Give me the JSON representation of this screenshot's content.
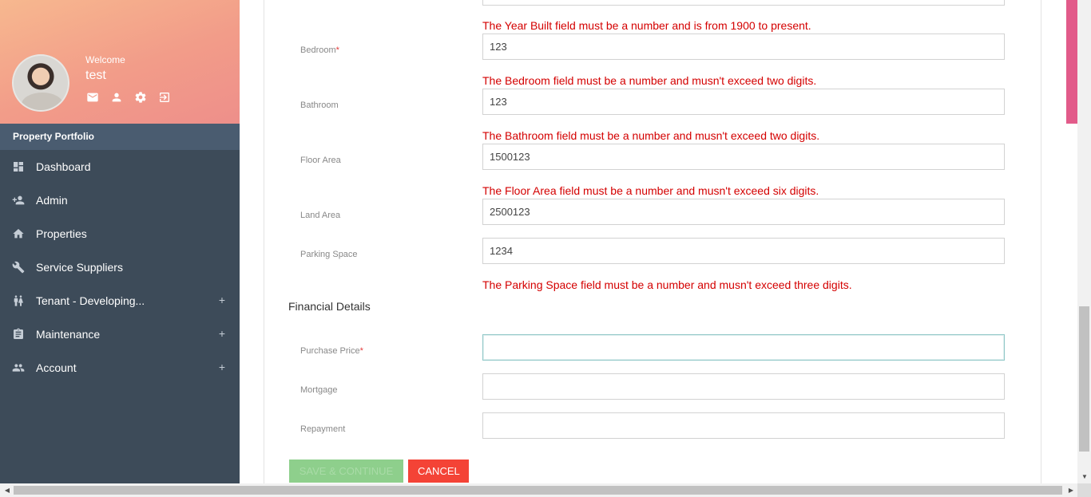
{
  "sidebar": {
    "welcome": "Welcome",
    "username": "test",
    "actions": [
      {
        "icon": "mail-icon"
      },
      {
        "icon": "profile-icon"
      },
      {
        "icon": "settings-icon"
      },
      {
        "icon": "logout-icon"
      }
    ],
    "section_title": "Property Portfolio",
    "items": [
      {
        "label": "Dashboard",
        "icon": "dashboard-icon",
        "expandable": false
      },
      {
        "label": "Admin",
        "icon": "add-user-icon",
        "expandable": false
      },
      {
        "label": "Properties",
        "icon": "home-icon",
        "expandable": false
      },
      {
        "label": "Service Suppliers",
        "icon": "wrench-icon",
        "expandable": false
      },
      {
        "label": "Tenant - Developing...",
        "icon": "people-icon",
        "expandable": true,
        "expand_symbol": "+"
      },
      {
        "label": "Maintenance",
        "icon": "clipboard-icon",
        "expandable": true,
        "expand_symbol": "+"
      },
      {
        "label": "Account",
        "icon": "group-icon",
        "expandable": true,
        "expand_symbol": "+"
      }
    ]
  },
  "form": {
    "errors": {
      "year_built": "The Year Built field must be a number and is from 1900 to present.",
      "bedroom": "The Bedroom field must be a number and musn't exceed two digits.",
      "bathroom": "The Bathroom field must be a number and musn't exceed two digits.",
      "floor_area": "The Floor Area field must be a number and musn't exceed six digits.",
      "parking_space": "The Parking Space field must be a number and musn't exceed three digits."
    },
    "fields": {
      "bedroom": {
        "label": "Bedroom",
        "required_mark": "*",
        "value": "123"
      },
      "bathroom": {
        "label": "Bathroom",
        "value": "123"
      },
      "floor_area": {
        "label": "Floor Area",
        "value": "1500123"
      },
      "land_area": {
        "label": "Land Area",
        "value": "2500123"
      },
      "parking_space": {
        "label": "Parking Space",
        "value": "1234"
      }
    },
    "financial_heading": "Financial Details",
    "financial": {
      "purchase_price": {
        "label": "Purchase Price",
        "required_mark": "*",
        "value": ""
      },
      "mortgage": {
        "label": "Mortgage",
        "value": ""
      },
      "repayment": {
        "label": "Repayment",
        "value": ""
      }
    },
    "buttons": {
      "save": "SAVE & CONTINUE",
      "cancel": "CANCEL"
    }
  },
  "colors": {
    "sidebar_bg": "#3d4b59",
    "section_bg": "#4a5c70",
    "error": "#d40000",
    "save_button": "#8ecf8c",
    "cancel_button": "#f44336",
    "accent_pink": "#e25b8a"
  }
}
